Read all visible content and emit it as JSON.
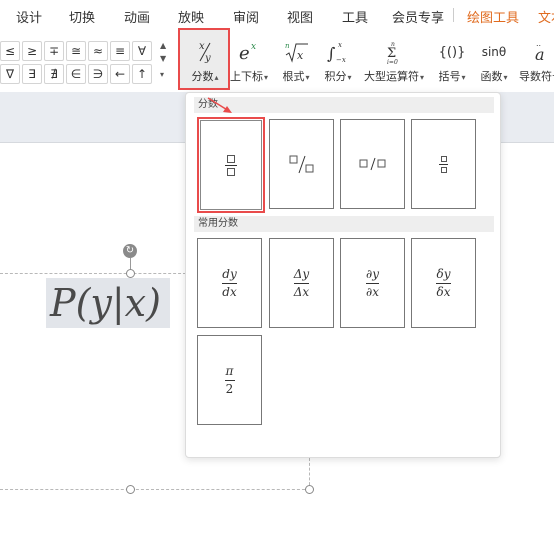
{
  "menubar": {
    "items": [
      "设计",
      "切换",
      "动画",
      "放映",
      "审阅",
      "视图",
      "工具",
      "会员专享"
    ],
    "contextual": [
      "绘图工具",
      "文本"
    ],
    "accent_color": "#e06b1f"
  },
  "ribbon": {
    "symbols_row1": [
      "≤",
      "≥",
      "∓",
      "≅",
      "≈",
      "≡",
      "∀"
    ],
    "symbols_row2": [
      "∇",
      "∃",
      "∄",
      "∈",
      "∋",
      "←",
      "↑"
    ],
    "tools": [
      {
        "label": "分数",
        "icon": "fraction-icon"
      },
      {
        "label": "上下标",
        "icon": "script-icon"
      },
      {
        "label": "根式",
        "icon": "radical-icon"
      },
      {
        "label": "积分",
        "icon": "integral-icon"
      },
      {
        "label": "大型运算符",
        "icon": "large-operator-icon"
      },
      {
        "label": "括号",
        "icon": "bracket-icon"
      },
      {
        "label": "函数",
        "icon": "function-icon"
      },
      {
        "label": "导数符号",
        "icon": "accent-icon"
      }
    ],
    "function_icon_text": "sinθ",
    "bracket_icon_text": "{()}"
  },
  "document": {
    "equation_text": "P(y|x)"
  },
  "dropdown": {
    "section1_title": "分数",
    "section2_title": "常用分数",
    "common": [
      {
        "num": "dy",
        "den": "dx"
      },
      {
        "num": "Δy",
        "den": "Δx"
      },
      {
        "num": "∂y",
        "den": "∂x"
      },
      {
        "num": "δy",
        "den": "δx"
      },
      {
        "num": "π",
        "den": "2"
      }
    ],
    "highlight_color": "#e94b4b"
  }
}
